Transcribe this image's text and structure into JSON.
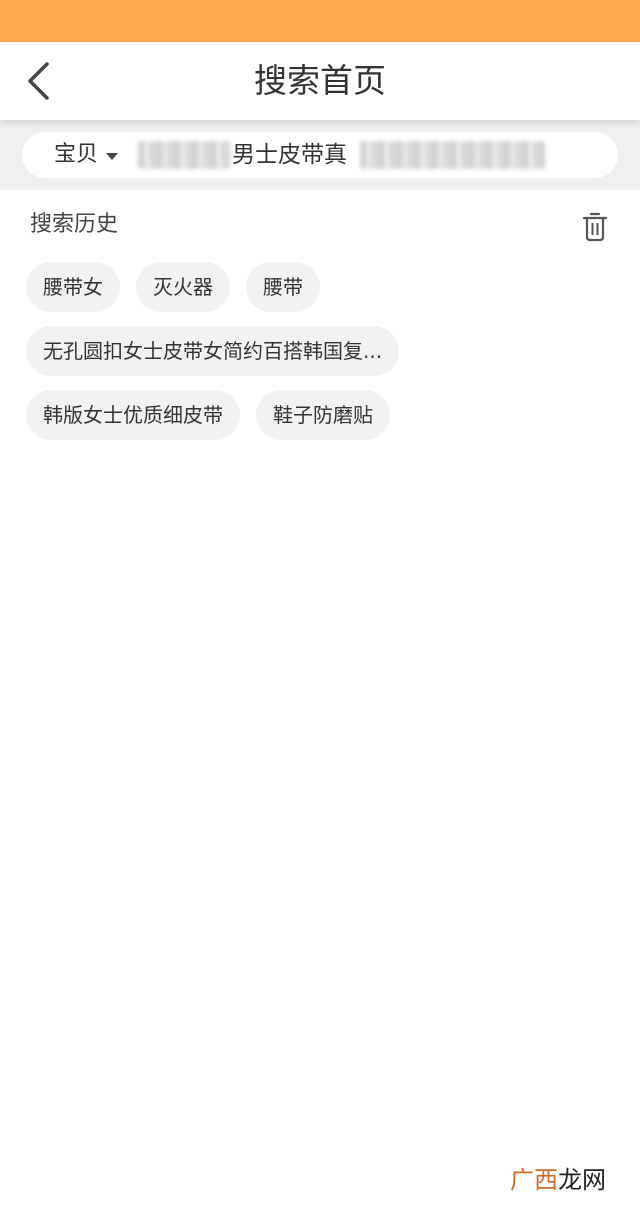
{
  "header": {
    "title": "搜索首页",
    "back_icon": "chevron-left-icon"
  },
  "search": {
    "scope_label": "宝贝",
    "query_visible": "男士皮带真"
  },
  "history": {
    "title": "搜索历史",
    "clear_icon": "trash-icon",
    "rows": [
      [
        "腰带女",
        "灭火器",
        "腰带"
      ],
      [
        "无孔圆扣女士皮带女简约百搭韩国复..."
      ],
      [
        "韩版女士优质细皮带",
        "鞋子防磨贴"
      ]
    ]
  },
  "watermark": {
    "part1": "广西",
    "part2": "龙网"
  },
  "colors": {
    "status_bar": "#FBA84E",
    "search_band": "#efefef",
    "chip_bg": "#f2f2f2"
  }
}
